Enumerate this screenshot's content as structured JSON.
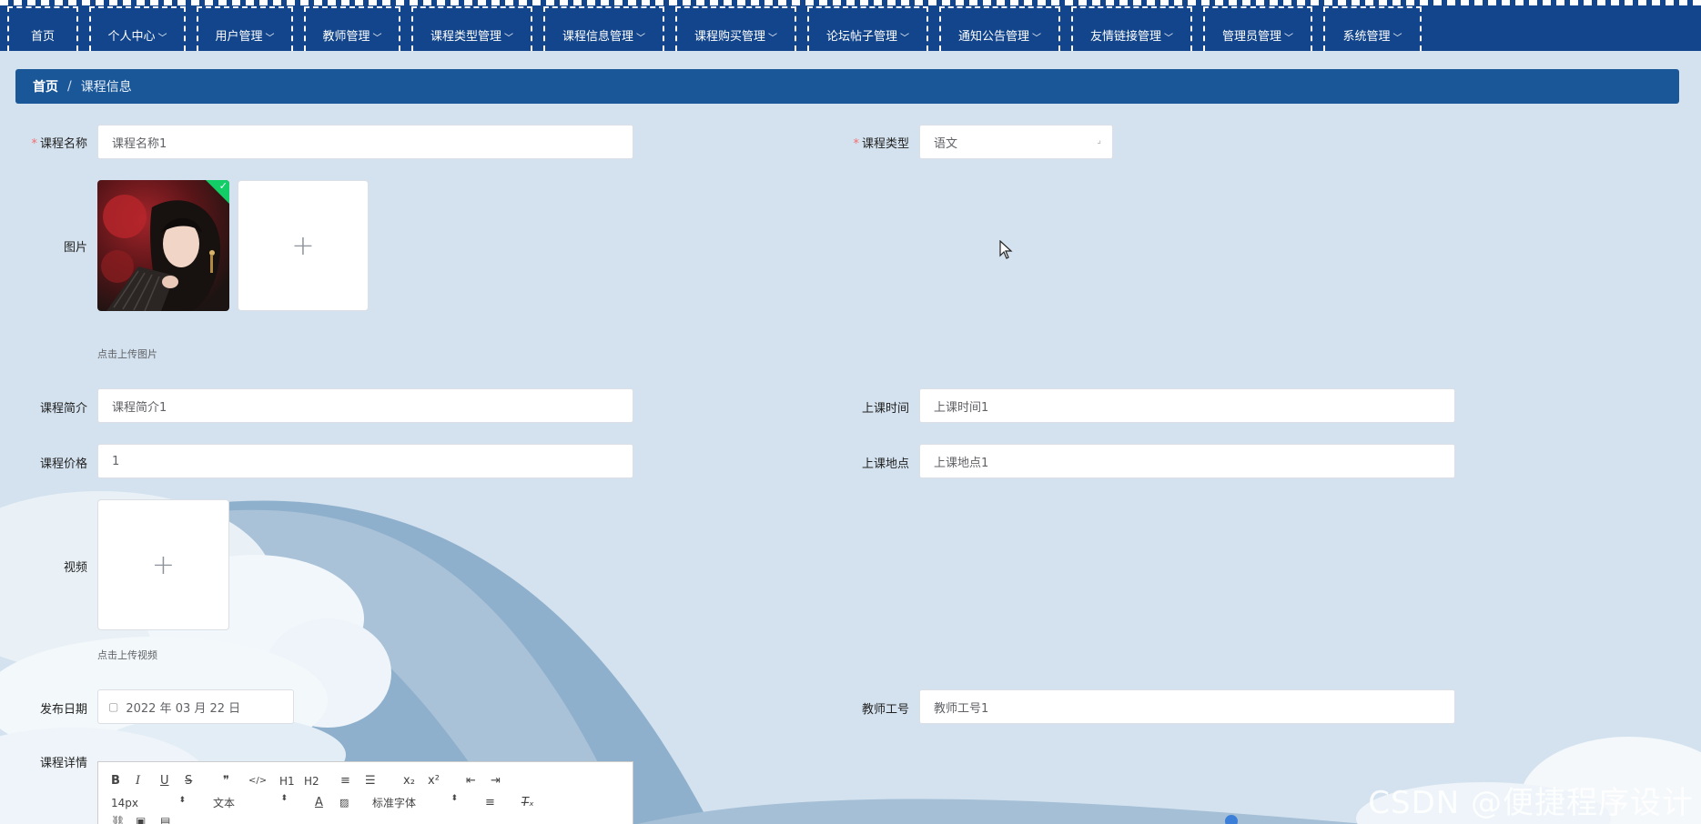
{
  "nav": {
    "items": [
      {
        "label": "首页",
        "dropdown": false
      },
      {
        "label": "个人中心",
        "dropdown": true
      },
      {
        "label": "用户管理",
        "dropdown": true
      },
      {
        "label": "教师管理",
        "dropdown": true
      },
      {
        "label": "课程类型管理",
        "dropdown": true
      },
      {
        "label": "课程信息管理",
        "dropdown": true
      },
      {
        "label": "课程购买管理",
        "dropdown": true
      },
      {
        "label": "论坛帖子管理",
        "dropdown": true
      },
      {
        "label": "通知公告管理",
        "dropdown": true
      },
      {
        "label": "友情链接管理",
        "dropdown": true
      },
      {
        "label": "管理员管理",
        "dropdown": true
      },
      {
        "label": "系统管理",
        "dropdown": true
      }
    ]
  },
  "breadcrumb": {
    "home": "首页",
    "separator": "/",
    "current": "课程信息"
  },
  "form": {
    "course_name": {
      "label": "课程名称",
      "required": true,
      "value": "课程名称1"
    },
    "course_type": {
      "label": "课程类型",
      "required": true,
      "value": "语文"
    },
    "image": {
      "label": "图片",
      "hint": "点击上传图片",
      "add_symbol": "+"
    },
    "intro": {
      "label": "课程简介",
      "value": "课程简介1"
    },
    "class_time": {
      "label": "上课时间",
      "value": "上课时间1"
    },
    "price": {
      "label": "课程价格",
      "value": "1"
    },
    "class_place": {
      "label": "上课地点",
      "value": "上课地点1"
    },
    "video": {
      "label": "视频",
      "hint": "点击上传视频",
      "add_symbol": "+"
    },
    "publish_date": {
      "label": "发布日期",
      "value": "2022 年 03 月 22 日"
    },
    "teacher_no": {
      "label": "教师工号",
      "value": "教师工号1"
    },
    "detail": {
      "label": "课程详情"
    }
  },
  "editor": {
    "row1": [
      "B",
      "I",
      "U",
      "S",
      "❞",
      "</>",
      "H1",
      "H2",
      "≡",
      "☰",
      "x₂",
      "x²",
      "⇤",
      "⇥"
    ],
    "font_size": "14px",
    "text_type": "文本",
    "font_family": "标准字体"
  },
  "watermark": "CSDN @便捷程序设计",
  "colors": {
    "nav_bg": "#12458b",
    "crumb_bg": "#1a5798",
    "page_bg": "#d4e2ef",
    "success": "#13ce66",
    "required": "#f56c6c"
  }
}
